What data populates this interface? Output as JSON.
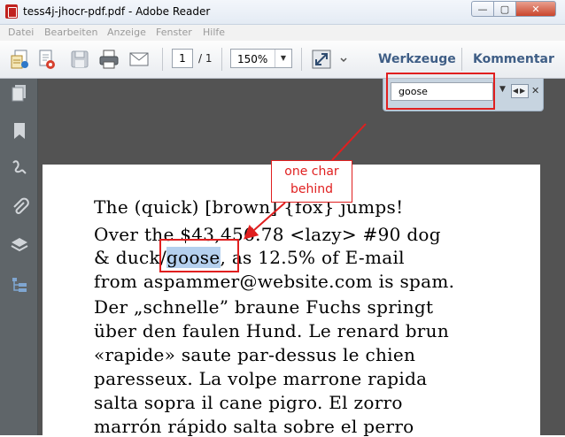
{
  "window": {
    "title": "tess4j-jhocr-pdf.pdf - Adobe Reader",
    "close_glyph": "✕",
    "min_glyph": "—",
    "max_glyph": "▢"
  },
  "menu": {
    "items": [
      "Datei",
      "Bearbeiten",
      "Anzeige",
      "Fenster",
      "Hilfe"
    ]
  },
  "toolbar": {
    "page_current": "1",
    "page_total": "/ 1",
    "zoom": "150%",
    "zoom_arrow": "▼",
    "tools_label": "Werkzeuge",
    "comment_label": "Kommentar"
  },
  "find": {
    "value": "goose",
    "dropdown_glyph": "▼",
    "nav_glyphs": "◀▶",
    "close_glyph": "✕"
  },
  "annotation": {
    "callout_line1": "one char",
    "callout_line2": "behind"
  },
  "document": {
    "lines": [
      {
        "text": "The (quick) [brown] {fox} jumps!"
      },
      {
        "text": "Over the $43,456.78 <lazy> #90 dog"
      },
      {
        "before": "& duck/",
        "highlight": "goose",
        "after": ", as 12.5% of E-mail"
      },
      {
        "text": "from aspammer@website.com is spam."
      },
      {
        "text": "Der „schnelle” braune Fuchs springt"
      },
      {
        "text": "über den faulen Hund. Le renard brun"
      },
      {
        "text": "«rapide» saute par-dessus le chien"
      },
      {
        "text": "paresseux. La volpe marrone rapida"
      },
      {
        "text": "salta sopra il cane pigro. El zorro"
      },
      {
        "text": "marrón rápido salta sobre el perro"
      }
    ]
  },
  "colors": {
    "accent_red": "#e01f1f",
    "highlight": "#b5d0ee",
    "link": "#3f5e86"
  }
}
